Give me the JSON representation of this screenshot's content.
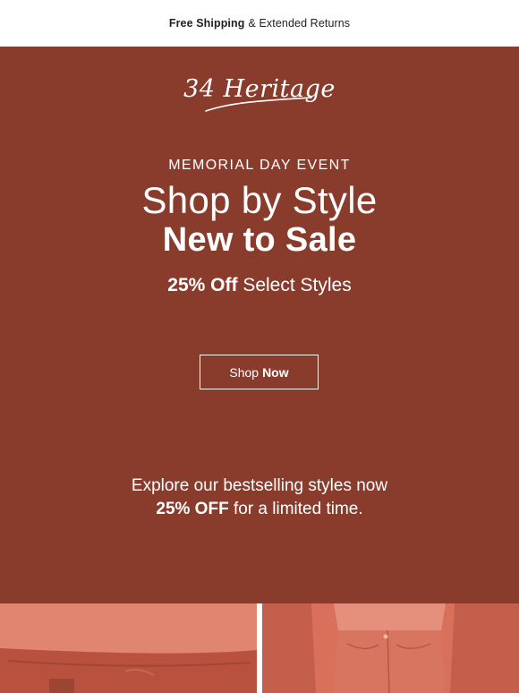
{
  "topbar": {
    "shipping_bold": "Free Shipping",
    "shipping_rest": "& Extended Returns"
  },
  "brand": {
    "logo_text": "34 Heritage"
  },
  "hero": {
    "kicker": "MEMORIAL DAY EVENT",
    "headline_line1": "Shop by Style",
    "headline_line2": "New to Sale",
    "offer_bold": "25% Off",
    "offer_rest": "Select Styles",
    "button_regular": "Shop",
    "button_bold": "Now",
    "explore_line1": "Explore our bestselling styles now",
    "explore_bold": "25% OFF",
    "explore_rest": "for a limited time."
  },
  "colors": {
    "hero_background": "#893c2c",
    "photo_tint": "#d9705b",
    "text": "#ffffff"
  }
}
